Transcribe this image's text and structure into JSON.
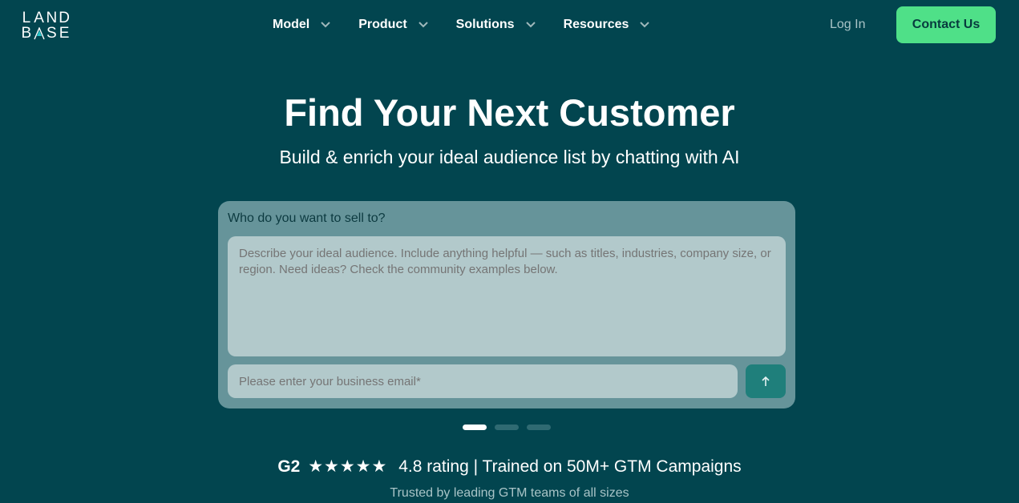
{
  "header": {
    "logo_line1": [
      "L",
      "A",
      "N",
      "D"
    ],
    "logo_line2": [
      "B",
      "A",
      "S",
      "E"
    ],
    "nav": [
      {
        "label": "Model"
      },
      {
        "label": "Product"
      },
      {
        "label": "Solutions"
      },
      {
        "label": "Resources"
      }
    ],
    "login_label": "Log In",
    "contact_label": "Contact Us"
  },
  "hero": {
    "title": "Find Your Next Customer",
    "subtitle": "Build & enrich your ideal audience list by chatting with AI"
  },
  "form": {
    "label": "Who do you want to sell to?",
    "audience_placeholder": "Describe your ideal audience. Include anything helpful — such as titles, industries, company size, or region. Need ideas? Check the community examples below.",
    "email_placeholder": "Please enter your business email*",
    "send_icon": "arrow-up-icon"
  },
  "pager": {
    "count": 3,
    "active_index": 0
  },
  "rating": {
    "g2": "G2",
    "stars": "★★★★★",
    "rating_text": "4.8 rating",
    "separator": "|",
    "trained_text": "Trained on 50M+ GTM Campaigns"
  },
  "trusted_text": "Trusted by leading GTM teams of all sizes",
  "colors": {
    "background": "#02454f",
    "accent": "#4fe088",
    "card": "#66949a",
    "input": "#b2c9cb",
    "send_button": "#1f7f7b"
  }
}
